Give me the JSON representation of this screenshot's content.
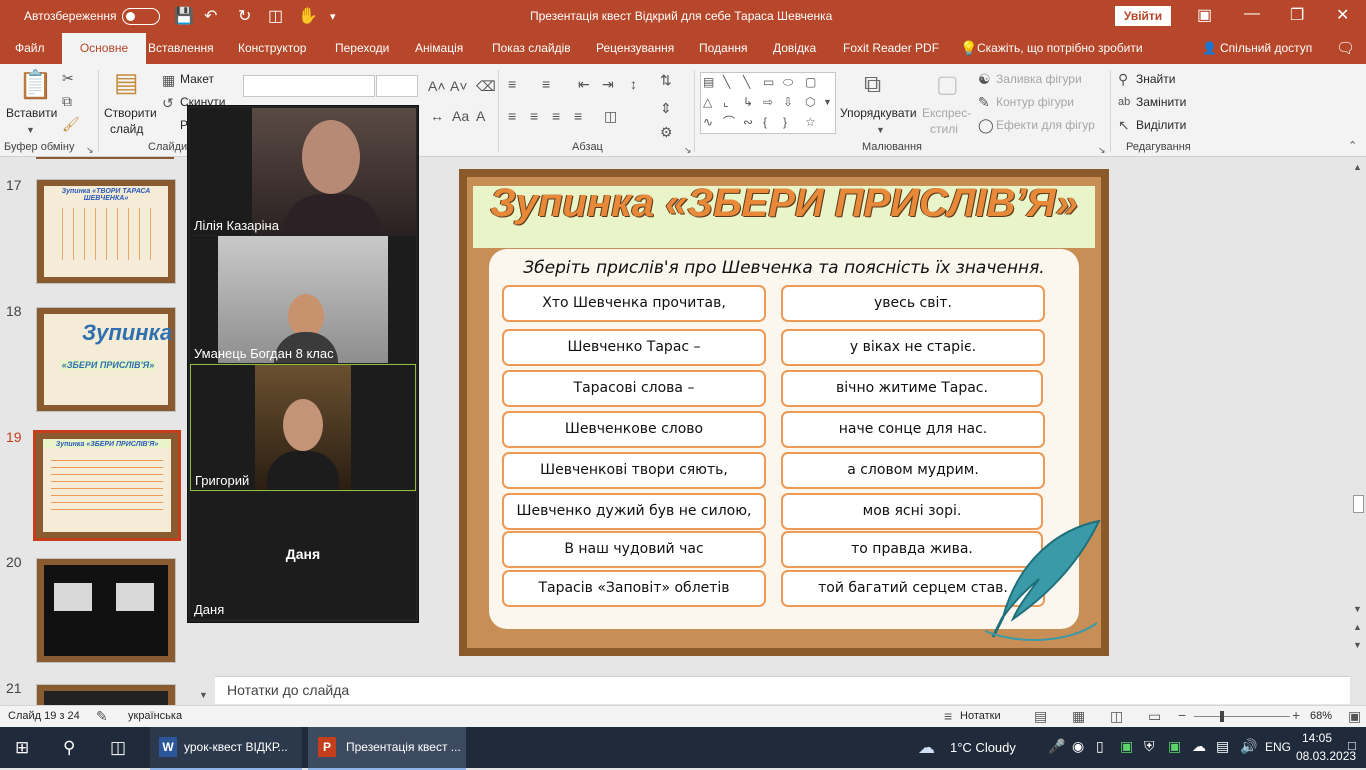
{
  "titlebar": {
    "autosave_label": "Автозбереження",
    "doc_title": "Презентація квест Відкрий для себе Тараса Шевченка",
    "signin_label": "Увійти"
  },
  "tabs": [
    "Файл",
    "Основне",
    "Вставлення",
    "Конструктор",
    "Переходи",
    "Анімація",
    "Показ слайдів",
    "Рецензування",
    "Подання",
    "Довідка",
    "Foxit Reader PDF"
  ],
  "tell_me": "Скажіть, що потрібно зробити",
  "share_label": "Спільний доступ",
  "ribbon": {
    "paste": "Вставити",
    "clipboard_group": "Буфер обміну",
    "new_slide_line1": "Створити",
    "new_slide_line2": "слайд",
    "layout": "Макет",
    "reset": "Скинути",
    "section_partial": "Р",
    "slides_group": "Слайди",
    "paragraph_group": "Абзац",
    "arrange": "Упорядкувати",
    "quick_styles_line1": "Експрес-",
    "quick_styles_line2": "стилі",
    "shape_fill": "Заливка фігури",
    "shape_outline": "Контур фігури",
    "shape_effects": "Ефекти для фігур",
    "drawing_group": "Малювання",
    "find": "Знайти",
    "replace": "Замінити",
    "select": "Виділити",
    "editing_group": "Редагування"
  },
  "thumbnails": [
    {
      "num": "17",
      "title": "Зупинка «ТВОРИ ТАРАСА ШЕВЧЕНКА»"
    },
    {
      "num": "18",
      "title": "Зупинка",
      "subtitle": "«ЗБЕРИ ПРИСЛІВ'Я»"
    },
    {
      "num": "19",
      "title": "Зупинка «ЗБЕРИ ПРИСЛІВ'Я»"
    },
    {
      "num": "20"
    },
    {
      "num": "21"
    }
  ],
  "slide": {
    "title": "Зупинка «ЗБЕРИ ПРИСЛІВ’Я»",
    "subtitle": "Зберіть прислів'я про Шевченка та поясність їх значення.",
    "left": [
      "Хто Шевченка прочитав,",
      "Шевченко Тарас –",
      "Тарасові слова –",
      "Шевченкове слово",
      "Шевченкові твори сяють,",
      "Шевченко дужий був не силою,",
      "В наш чудовий час",
      "Тарасів «Заповіт» облетів"
    ],
    "right": [
      "увесь світ.",
      "у віках не старіє.",
      "вічно житиме Тарас.",
      "наче сонце для нас.",
      "а словом мудрим.",
      "мов ясні зорі.",
      "то правда жива.",
      "той багатий серцем став."
    ]
  },
  "notes_placeholder": "Нотатки до слайда",
  "video_participants": [
    {
      "name": "Лілія Казаріна"
    },
    {
      "name": "Уманець Богдан 8 клас"
    },
    {
      "name": "Григорий"
    },
    {
      "name": "Даня",
      "center_label": "Даня"
    }
  ],
  "status": {
    "slide_of": "Слайд 19 з 24",
    "language": "українська",
    "notes_btn": "Нотатки",
    "zoom": "68%"
  },
  "taskbar": {
    "word_item": "урок-квест ВІДКР...",
    "ppt_item": "Презентація квест ...",
    "weather": "1°C  Cloudy",
    "lang": "ENG",
    "time": "14:05",
    "date": "08.03.2023"
  },
  "colors": {
    "ppt_accent": "#b7472a",
    "slide_title": "#e8893a",
    "pill_border": "#ec9a55",
    "selected_thumb": "#c43e1c"
  }
}
